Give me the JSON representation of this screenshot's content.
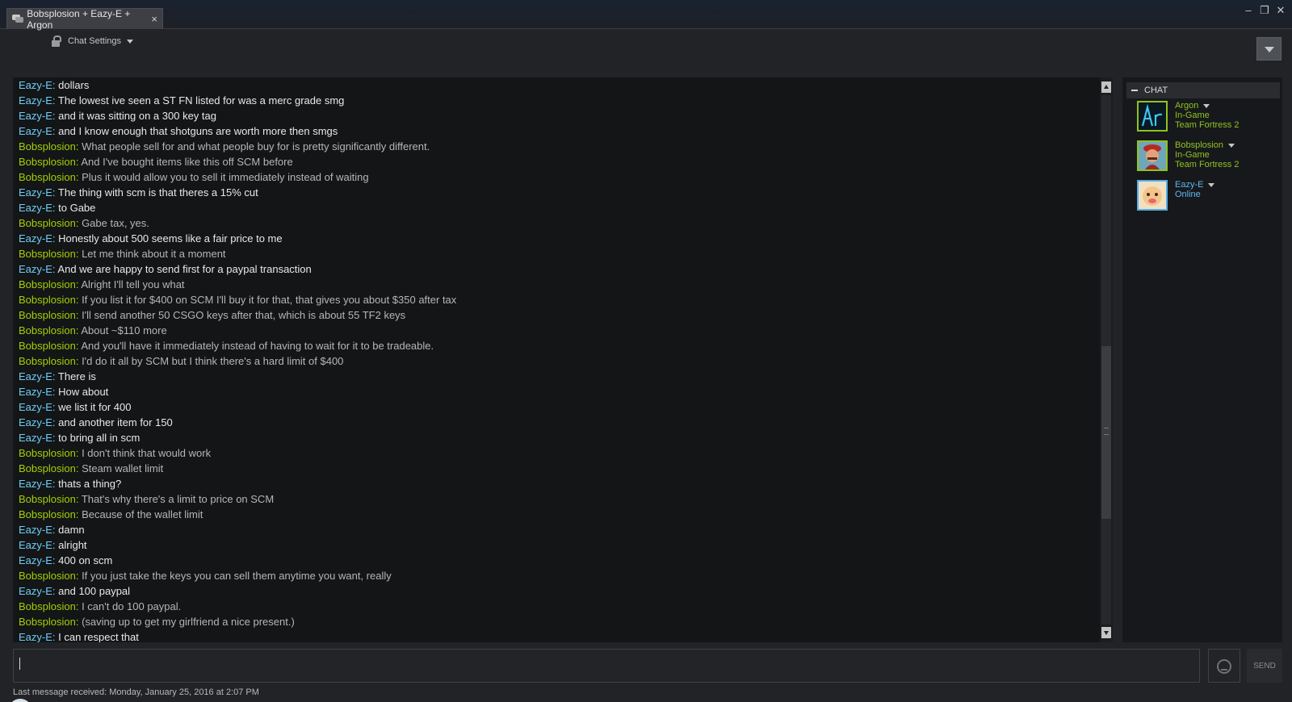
{
  "window": {
    "tab_title": "Bobsplosion + Eazy-E + Argon",
    "tab_close": "×",
    "minimize": "–",
    "maximize": "❐",
    "close": "✕"
  },
  "toolbar": {
    "settings_label": "Chat Settings"
  },
  "messages": [
    {
      "name": "Eazy-E",
      "text": "dollars",
      "who": "eazy"
    },
    {
      "name": "Eazy-E",
      "text": "The lowest ive seen a ST FN listed for was a merc grade smg",
      "who": "eazy"
    },
    {
      "name": "Eazy-E",
      "text": "and it was sitting on a 300 key tag",
      "who": "eazy"
    },
    {
      "name": "Eazy-E",
      "text": "and I know enough that shotguns are worth more then smgs",
      "who": "eazy"
    },
    {
      "name": "Bobsplosion",
      "text": "What people sell for and what people buy for is pretty significantly different.",
      "who": "bob"
    },
    {
      "name": "Bobsplosion",
      "text": "And I've bought items like this off SCM before",
      "who": "bob"
    },
    {
      "name": "Bobsplosion",
      "text": "Plus it would allow you to sell it immediately instead of waiting",
      "who": "bob"
    },
    {
      "name": "Eazy-E",
      "text": "The thing with scm is that theres a 15% cut",
      "who": "eazy"
    },
    {
      "name": "Eazy-E",
      "text": "to Gabe",
      "who": "eazy"
    },
    {
      "name": "Bobsplosion",
      "text": "Gabe tax, yes.",
      "who": "bob"
    },
    {
      "name": "Eazy-E",
      "text": "Honestly about 500 seems like a fair price to me",
      "who": "eazy"
    },
    {
      "name": "Bobsplosion",
      "text": "Let me think about it a moment",
      "who": "bob"
    },
    {
      "name": "Eazy-E",
      "text": "And we are happy to send first for a paypal transaction",
      "who": "eazy"
    },
    {
      "name": "Bobsplosion",
      "text": "Alright I'll tell you what",
      "who": "bob"
    },
    {
      "name": "Bobsplosion",
      "text": "If you list it for $400 on SCM I'll buy it for that, that gives you about $350 after tax",
      "who": "bob"
    },
    {
      "name": "Bobsplosion",
      "text": "I'll send another 50 CSGO keys after that, which is about 55 TF2 keys",
      "who": "bob"
    },
    {
      "name": "Bobsplosion",
      "text": "About ~$110 more",
      "who": "bob"
    },
    {
      "name": "Bobsplosion",
      "text": "And you'll have it immediately instead of having to wait for it to be tradeable.",
      "who": "bob"
    },
    {
      "name": "Bobsplosion",
      "text": "I'd do it all by SCM but I think there's a hard limit of $400",
      "who": "bob"
    },
    {
      "name": "Eazy-E",
      "text": "There is",
      "who": "eazy"
    },
    {
      "name": "Eazy-E",
      "text": "How about",
      "who": "eazy"
    },
    {
      "name": "Eazy-E",
      "text": "we list it for 400",
      "who": "eazy"
    },
    {
      "name": "Eazy-E",
      "text": "and another item for 150",
      "who": "eazy"
    },
    {
      "name": "Eazy-E",
      "text": "to bring all in scm",
      "who": "eazy"
    },
    {
      "name": "Bobsplosion",
      "text": "I don't think that would work",
      "who": "bob"
    },
    {
      "name": "Bobsplosion",
      "text": "Steam wallet limit",
      "who": "bob"
    },
    {
      "name": "Eazy-E",
      "text": "thats a thing?",
      "who": "eazy"
    },
    {
      "name": "Bobsplosion",
      "text": "That's why there's a limit to price on SCM",
      "who": "bob"
    },
    {
      "name": "Bobsplosion",
      "text": "Because of the wallet limit",
      "who": "bob"
    },
    {
      "name": "Eazy-E",
      "text": "damn",
      "who": "eazy"
    },
    {
      "name": "Eazy-E",
      "text": "alright",
      "who": "eazy"
    },
    {
      "name": "Eazy-E",
      "text": "400 on scm",
      "who": "eazy"
    },
    {
      "name": "Bobsplosion",
      "text": "If you just take the keys you can sell them anytime you want, really",
      "who": "bob"
    },
    {
      "name": "Eazy-E",
      "text": "and 100 paypal",
      "who": "eazy"
    },
    {
      "name": "Bobsplosion",
      "text": "I can't do 100 paypal.",
      "who": "bob"
    },
    {
      "name": "Bobsplosion",
      "text": "(saving up to get my girlfriend a nice present.)",
      "who": "bob"
    },
    {
      "name": "Eazy-E",
      "text": "I can respect that",
      "who": "eazy"
    }
  ],
  "members_panel": {
    "header": "CHAT",
    "members": [
      {
        "name": "Argon",
        "status": "In-Game",
        "game": "Team Fortress 2",
        "avatar_icon": "argon-avatar"
      },
      {
        "name": "Bobsplosion",
        "status": "In-Game",
        "game": "Team Fortress 2",
        "avatar_icon": "bobsplosion-avatar"
      },
      {
        "name": "Eazy-E",
        "status": "Online",
        "game": "",
        "avatar_icon": "eazy-e-avatar"
      }
    ]
  },
  "composer": {
    "send_label": "SEND",
    "emoticon_icon": "emoticon-icon"
  },
  "footer": {
    "last_received": "Last message received: Monday, January 25, 2016 at 2:07 PM"
  },
  "colors": {
    "eazy_name": "#6dcff6",
    "bob_name": "#a3cf06",
    "ingame": "#8fc221",
    "online": "#5cb8ef",
    "background": "#222326"
  }
}
